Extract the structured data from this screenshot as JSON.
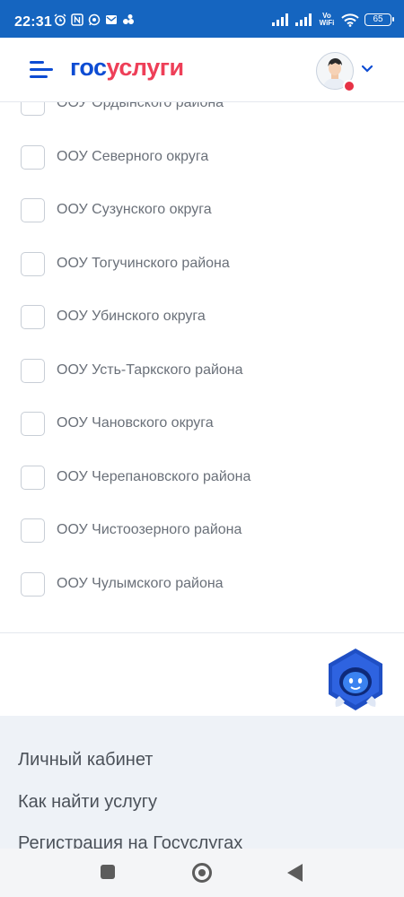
{
  "status_bar": {
    "time": "22:31",
    "left_icons": [
      "alarm-icon",
      "nfc-icon",
      "whatsapp-icon",
      "mail-icon",
      "apps-icon"
    ],
    "right_icons": [
      "signal-icon",
      "signal-icon",
      "vowifi-icon",
      "wifi-icon",
      "battery-icon"
    ],
    "vowifi_label": "Vo WiFi",
    "battery_level": "65"
  },
  "header": {
    "logo_part1": "гос",
    "logo_part2": "услуги",
    "brand_blue": "#0d4cd3",
    "brand_red": "#ee3f58",
    "menu_icon": "hamburger-menu-icon",
    "avatar_icon": "user-avatar-icon",
    "notification_dot_color": "#e63245",
    "dropdown_icon": "chevron-down-icon"
  },
  "filter_list": {
    "items": [
      {
        "label": "ООУ Ордынского района",
        "checked": false
      },
      {
        "label": "ООУ Северного округа",
        "checked": false
      },
      {
        "label": "ООУ Сузунского округа",
        "checked": false
      },
      {
        "label": "ООУ Тогучинского района",
        "checked": false
      },
      {
        "label": "ООУ Убинского округа",
        "checked": false
      },
      {
        "label": "ООУ Усть-Таркского района",
        "checked": false
      },
      {
        "label": "ООУ Чановского округа",
        "checked": false
      },
      {
        "label": "ООУ Черепановского района",
        "checked": false
      },
      {
        "label": "ООУ Чистоозерного района",
        "checked": false
      },
      {
        "label": "ООУ Чулымского района",
        "checked": false
      }
    ]
  },
  "assistant": {
    "icon": "robot-assistant-icon"
  },
  "footer": {
    "links": [
      "Личный кабинет",
      "Как найти услугу",
      "Регистрация на Госуслугах"
    ]
  },
  "nav_bar": {
    "icons": [
      "recent-apps-icon",
      "home-icon",
      "back-icon"
    ]
  }
}
